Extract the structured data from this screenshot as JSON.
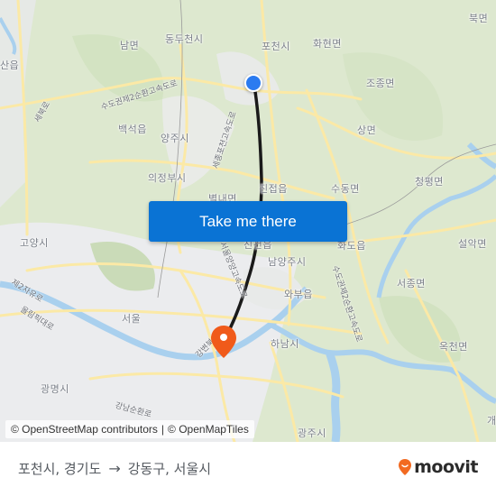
{
  "map": {
    "places": [
      {
        "id": "nammyeon",
        "label": "남면"
      },
      {
        "id": "dongducheon",
        "label": "동두천시"
      },
      {
        "id": "pocheon",
        "label": "포천시"
      },
      {
        "id": "hwahyeon",
        "label": "화현면"
      },
      {
        "id": "bukmyeon",
        "label": "북면"
      },
      {
        "id": "sanup",
        "label": "산읍"
      },
      {
        "id": "jojong",
        "label": "조종면"
      },
      {
        "id": "baekseok",
        "label": "백석읍"
      },
      {
        "id": "yangju",
        "label": "양주시"
      },
      {
        "id": "sangmyeon",
        "label": "상면"
      },
      {
        "id": "uijeongbu",
        "label": "의정부시"
      },
      {
        "id": "jinjeop",
        "label": "진접읍"
      },
      {
        "id": "sudong",
        "label": "수동면"
      },
      {
        "id": "cheongpyeong",
        "label": "청평면"
      },
      {
        "id": "byeollae",
        "label": "별내면"
      },
      {
        "id": "goyang",
        "label": "고양시"
      },
      {
        "id": "jingeon",
        "label": "진건읍"
      },
      {
        "id": "hwado",
        "label": "화도읍"
      },
      {
        "id": "seorak",
        "label": "설악면"
      },
      {
        "id": "namyangju",
        "label": "남양주시"
      },
      {
        "id": "wabu",
        "label": "와부읍"
      },
      {
        "id": "seojong",
        "label": "서종면"
      },
      {
        "id": "seoul",
        "label": "서울"
      },
      {
        "id": "hanam",
        "label": "하남시"
      },
      {
        "id": "okcheon",
        "label": "옥천면"
      },
      {
        "id": "gwangmyeong",
        "label": "광명시"
      },
      {
        "id": "gwangju",
        "label": "광주시"
      },
      {
        "id": "gae",
        "label": "개"
      }
    ],
    "roads": [
      {
        "id": "capital-ring-2",
        "label": "수도권제2순환고속도로"
      },
      {
        "id": "sebuk",
        "label": "세북로"
      },
      {
        "id": "sejong-pocheon",
        "label": "세종포천고속도로"
      },
      {
        "id": "jayu",
        "label": "제2자유로"
      },
      {
        "id": "olympic",
        "label": "올림픽대로"
      },
      {
        "id": "gangbyeon",
        "label": "강변북로"
      },
      {
        "id": "nambu-ring",
        "label": "강남순환로"
      },
      {
        "id": "capital-ring-2b",
        "label": "수도권제2순환고속도로"
      },
      {
        "id": "seoul-yangyang",
        "label": "서울양양고속도로"
      }
    ],
    "cta_label": "Take me there",
    "attribution": {
      "osm": "© OpenStreetMap contributors",
      "separator": "|",
      "omt": "© OpenMapTiles"
    },
    "colors": {
      "route": "#1a1a1a",
      "origin": "#2b7bf0",
      "destination": "#f05a1a",
      "button": "#0a73d4"
    }
  },
  "footer": {
    "origin": "포천시, 경기도",
    "arrow": "→",
    "destination": "강동구, 서울시",
    "brand": "moovit",
    "brand_color": "#f26a21"
  }
}
